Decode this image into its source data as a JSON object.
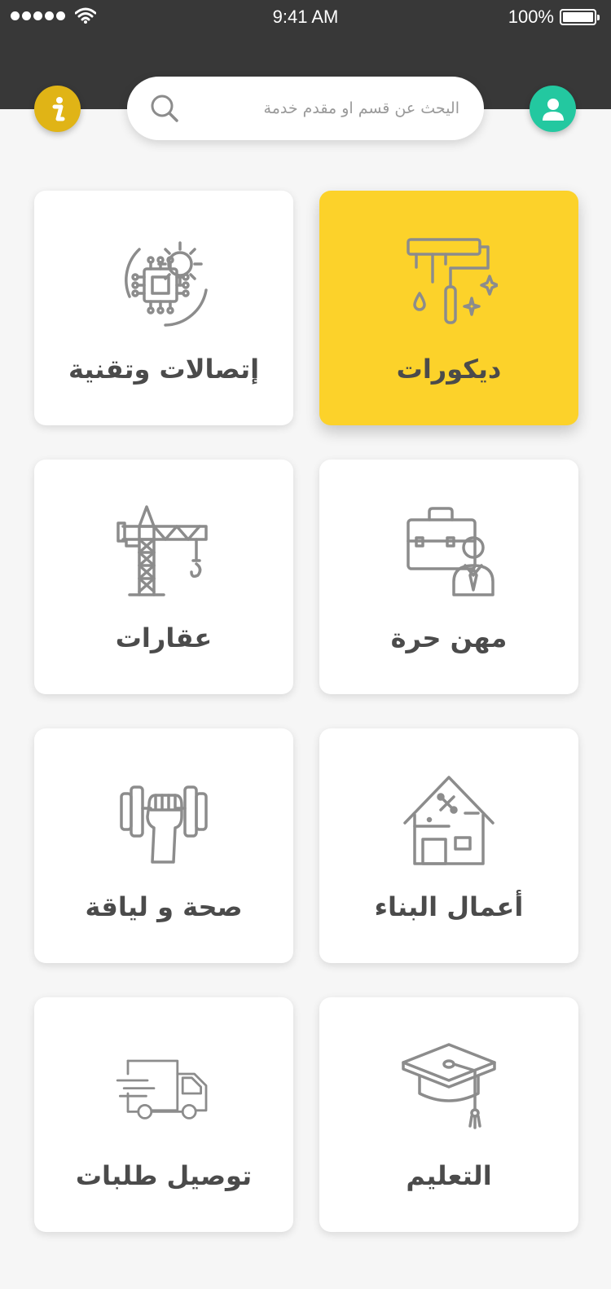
{
  "status_bar": {
    "time": "9:41 AM",
    "battery": "100%",
    "battery_level": 1.0,
    "signal_bars": 5
  },
  "header": {
    "search": {
      "placeholder": "اليحث عن قسم او مقدم خدمة"
    },
    "info_icon": "info-icon",
    "profile_icon": "user-icon"
  },
  "colors": {
    "header_bg": "#383838",
    "accent_yellow": "#fcd22a",
    "info_button": "#e0b416",
    "profile_button": "#23c8a0",
    "icon_gray": "#8c8c8c",
    "label_text": "#4b4b4b"
  },
  "categories": [
    {
      "label": "ديكورات",
      "icon": "paint-roller-icon",
      "selected": true
    },
    {
      "label": "إتصالات وتقنية",
      "icon": "chip-gear-icon",
      "selected": false
    },
    {
      "label": "مهن حرة",
      "icon": "businessman-briefcase-icon",
      "selected": false
    },
    {
      "label": "عقارات",
      "icon": "construction-crane-icon",
      "selected": false
    },
    {
      "label": "أعمال البناء",
      "icon": "house-tools-icon",
      "selected": false
    },
    {
      "label": "صحة و لياقة",
      "icon": "dumbbell-fist-icon",
      "selected": false
    },
    {
      "label": "التعليم",
      "icon": "graduation-cap-icon",
      "selected": false
    },
    {
      "label": "توصيل طلبات",
      "icon": "delivery-truck-icon",
      "selected": false
    }
  ]
}
